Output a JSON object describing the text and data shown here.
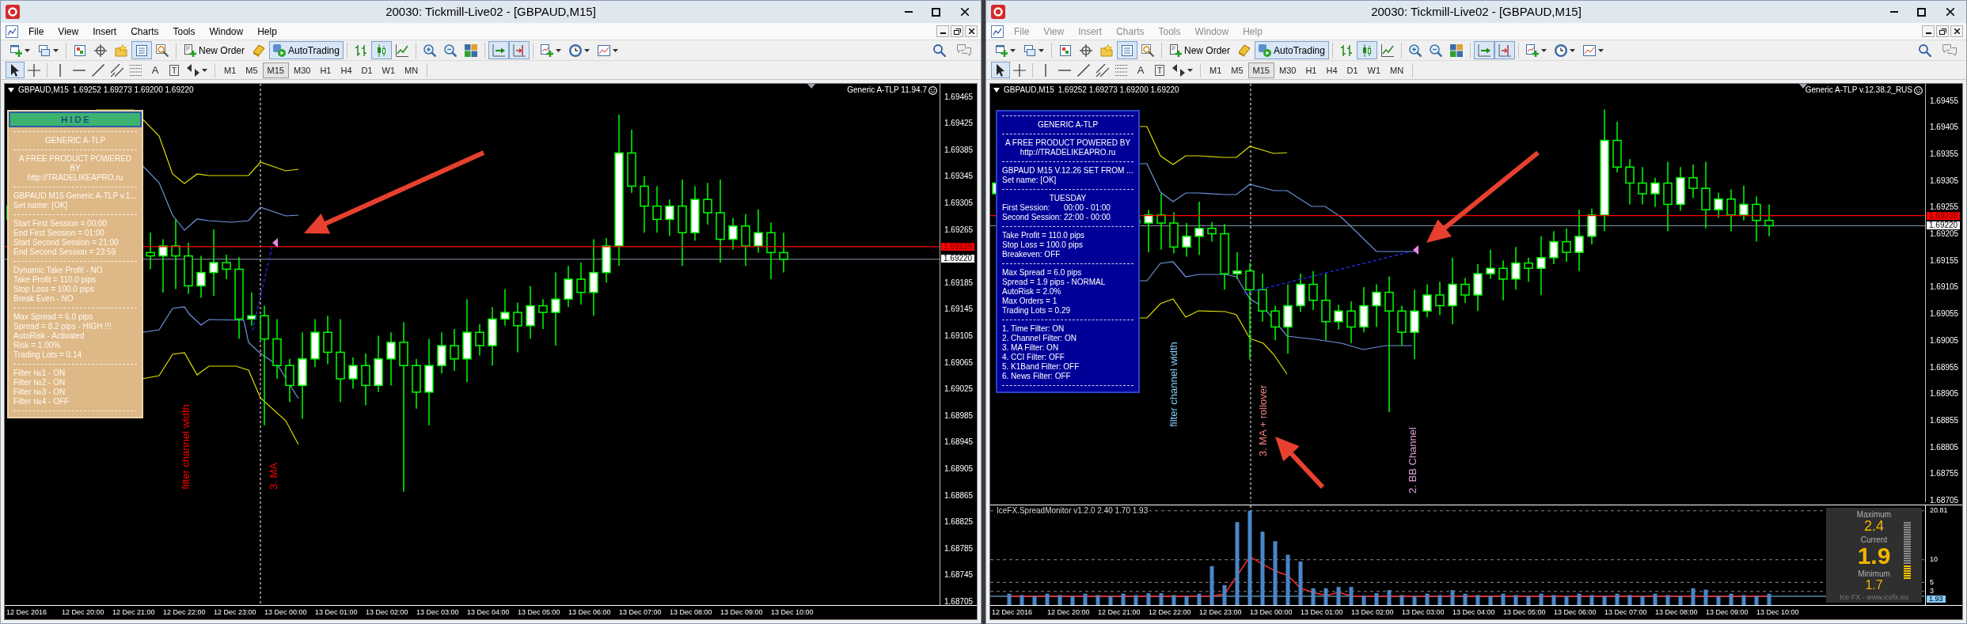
{
  "windows": [
    {
      "title": "20030: Tickmill-Live02 - [GBPAUD,M15]",
      "focused": true,
      "menu": [
        "File",
        "View",
        "Insert",
        "Charts",
        "Tools",
        "Window",
        "Help"
      ],
      "toolbar": [
        {
          "kind": "chart",
          "selected": false
        },
        {
          "kind": "profiles",
          "selected": false
        },
        {
          "kind": "market",
          "selected": false
        },
        {
          "kind": "navigator",
          "selected": false
        },
        {
          "kind": "favorites",
          "selected": false
        },
        {
          "kind": "datawindow",
          "selected": true
        },
        {
          "kind": "tester",
          "selected": false
        },
        {
          "kind": "order",
          "label": "New Order",
          "selected": false
        },
        {
          "kind": "editor",
          "selected": false
        },
        {
          "kind": "autotrading",
          "label": "AutoTrading",
          "selected": true
        },
        {
          "kind": "bars",
          "selected": false
        },
        {
          "kind": "candles",
          "selected": true
        },
        {
          "kind": "line",
          "selected": false
        },
        {
          "kind": "zoomin",
          "selected": false
        },
        {
          "kind": "zoomout",
          "selected": false
        },
        {
          "kind": "tile",
          "selected": false
        },
        {
          "kind": "autoscroll",
          "selected": true
        },
        {
          "kind": "shift",
          "selected": true
        },
        {
          "kind": "indicators",
          "selected": false
        },
        {
          "kind": "periods",
          "selected": false
        },
        {
          "kind": "templates",
          "selected": false
        }
      ],
      "drawing_tools": [
        {
          "kind": "cursor",
          "selected": true
        },
        {
          "kind": "crosshair",
          "selected": false
        },
        {
          "kind": "vline",
          "selected": false
        },
        {
          "kind": "hline",
          "selected": false
        },
        {
          "kind": "trendline",
          "selected": false
        },
        {
          "kind": "channel",
          "selected": false
        },
        {
          "kind": "fibo",
          "selected": false
        },
        {
          "kind": "text",
          "label": "A",
          "selected": false
        },
        {
          "kind": "label",
          "label": "T",
          "selected": false
        },
        {
          "kind": "arrows",
          "selected": false
        }
      ],
      "timeframes": [
        {
          "label": "M1",
          "selected": false
        },
        {
          "label": "M5",
          "selected": false
        },
        {
          "label": "M15",
          "selected": true
        },
        {
          "label": "M30",
          "selected": false
        },
        {
          "label": "H1",
          "selected": false
        },
        {
          "label": "H4",
          "selected": false
        },
        {
          "label": "D1",
          "selected": false
        },
        {
          "label": "W1",
          "selected": false
        },
        {
          "label": "MN",
          "selected": false
        }
      ],
      "chart": {
        "symbol": "GBPAUD,M15",
        "quote": "1.69252 1.69273 1.69200 1.69220",
        "expert": "Generic A-TLP 11.94.7",
        "panel": {
          "kind": "tan",
          "hide_button": "H I D E",
          "sections": [
            [
              {
                "kind": "heading",
                "text": "GENERIC A-TLP"
              }
            ],
            [
              {
                "kind": "heading",
                "text": "A FREE PRODUCT POWERED"
              },
              {
                "kind": "heading",
                "text": "BY"
              },
              {
                "kind": "heading",
                "text": "http://TRADELIKEAPRO.ru"
              }
            ],
            [
              {
                "kind": "line",
                "text": "GBPAUD M15 Generic A-TLP v.1..."
              },
              {
                "kind": "line",
                "text": "Set name: [OK]"
              }
            ],
            [
              {
                "kind": "line",
                "text": "Start First Session = 00:00"
              },
              {
                "kind": "line",
                "text": "End First Session = 01:00"
              },
              {
                "kind": "line",
                "text": "Start Second Session = 21:00"
              },
              {
                "kind": "line",
                "text": "End Second Session = 23:59"
              }
            ],
            [
              {
                "kind": "line",
                "text": "Dynamic Take Profit - NO"
              },
              {
                "kind": "line",
                "text": "Take Profit = 110.0 pips"
              },
              {
                "kind": "line",
                "text": "Stop Loss = 100.0 pips"
              },
              {
                "kind": "line",
                "text": "Break Even - NO"
              }
            ],
            [
              {
                "kind": "line",
                "text": "Max Spread = 6.0 pips"
              },
              {
                "kind": "line",
                "text": "Spread = 8.2 pips - HIGH !!!"
              },
              {
                "kind": "line",
                "text": "AutoRisk - Activated"
              },
              {
                "kind": "line",
                "text": "Risk = 1.00%"
              },
              {
                "kind": "line",
                "text": "Trading Lots = 0.14"
              }
            ],
            [
              {
                "kind": "line",
                "text": "Filter №1 - ON"
              },
              {
                "kind": "line",
                "text": "Filter №2 - ON"
              },
              {
                "kind": "line",
                "text": "Filter №3 - ON"
              },
              {
                "kind": "line",
                "text": "Filter №4 - OFF"
              }
            ]
          ]
        },
        "annotations": [
          {
            "text": "filter channel width",
            "color": "#ff0000"
          },
          {
            "text": "3. MA",
            "color": "#ff0000"
          }
        ],
        "price_axis": {
          "labels": [
            "1.69465",
            "1.69425",
            "1.69385",
            "1.69345",
            "1.69305",
            "1.69265",
            "1.69185",
            "1.69145",
            "1.69105",
            "1.69065",
            "1.69025",
            "1.68985",
            "1.68945",
            "1.68905",
            "1.68865",
            "1.68825",
            "1.68785",
            "1.68745",
            "1.68705"
          ],
          "ask": "1.69239",
          "bid": "1.69220"
        },
        "time_axis": [
          "12 Dec 2016",
          "12 Dec 20:00",
          "12 Dec 21:00",
          "12 Dec 22:00",
          "12 Dec 23:00",
          "13 Dec 00:00",
          "13 Dec 01:00",
          "13 Dec 02:00",
          "13 Dec 03:00",
          "13 Dec 04:00",
          "13 Dec 05:00",
          "13 Dec 06:00",
          "13 Dec 07:00",
          "13 Dec 08:00",
          "13 Dec 09:00",
          "13 Dec 10:00"
        ]
      }
    },
    {
      "title": "20030: Tickmill-Live02 - [GBPAUD,M15]",
      "focused": false,
      "menu": [
        "File",
        "View",
        "Insert",
        "Charts",
        "Tools",
        "Window",
        "Help"
      ],
      "toolbar": [
        {
          "kind": "chart",
          "selected": false
        },
        {
          "kind": "profiles",
          "selected": false
        },
        {
          "kind": "market",
          "selected": false
        },
        {
          "kind": "navigator",
          "selected": false
        },
        {
          "kind": "favorites",
          "selected": false
        },
        {
          "kind": "datawindow",
          "selected": true
        },
        {
          "kind": "tester",
          "selected": false
        },
        {
          "kind": "order",
          "label": "New Order",
          "selected": false
        },
        {
          "kind": "editor",
          "selected": false
        },
        {
          "kind": "autotrading",
          "label": "AutoTrading",
          "selected": true
        },
        {
          "kind": "bars",
          "selected": false
        },
        {
          "kind": "candles",
          "selected": true
        },
        {
          "kind": "line",
          "selected": false
        },
        {
          "kind": "zoomin",
          "selected": false
        },
        {
          "kind": "zoomout",
          "selected": false
        },
        {
          "kind": "tile",
          "selected": false
        },
        {
          "kind": "autoscroll",
          "selected": true
        },
        {
          "kind": "shift",
          "selected": true
        },
        {
          "kind": "indicators",
          "selected": false
        },
        {
          "kind": "periods",
          "selected": false
        },
        {
          "kind": "templates",
          "selected": false
        }
      ],
      "drawing_tools": [
        {
          "kind": "cursor",
          "selected": true
        },
        {
          "kind": "crosshair",
          "selected": false
        },
        {
          "kind": "vline",
          "selected": false
        },
        {
          "kind": "hline",
          "selected": false
        },
        {
          "kind": "trendline",
          "selected": false
        },
        {
          "kind": "channel",
          "selected": false
        },
        {
          "kind": "fibo",
          "selected": false
        },
        {
          "kind": "text",
          "label": "A",
          "selected": false
        },
        {
          "kind": "label",
          "label": "T",
          "selected": false
        },
        {
          "kind": "arrows",
          "selected": false
        }
      ],
      "timeframes": [
        {
          "label": "M1",
          "selected": false
        },
        {
          "label": "M5",
          "selected": false
        },
        {
          "label": "M15",
          "selected": true
        },
        {
          "label": "M30",
          "selected": false
        },
        {
          "label": "H1",
          "selected": false
        },
        {
          "label": "H4",
          "selected": false
        },
        {
          "label": "D1",
          "selected": false
        },
        {
          "label": "W1",
          "selected": false
        },
        {
          "label": "MN",
          "selected": false
        }
      ],
      "chart": {
        "symbol": "GBPAUD,M15",
        "quote": "1.69252 1.69273 1.69200 1.69220",
        "expert": "Generic A-TLP v.12.38.2_RUS",
        "panel": {
          "kind": "navy",
          "sections": [
            [
              {
                "kind": "heading",
                "text": "GENERIC A-TLP"
              }
            ],
            [
              {
                "kind": "heading",
                "text": "A FREE PRODUCT POWERED BY"
              },
              {
                "kind": "heading",
                "text": "http://TRADELIKEAPRO.ru"
              }
            ],
            [
              {
                "kind": "line",
                "text": "GBPAUD M15 V.12.26 SET FROM ..."
              },
              {
                "kind": "line",
                "text": "Set name: [OK]"
              }
            ],
            [
              {
                "kind": "heading",
                "text": "TUESDAY"
              },
              {
                "kind": "pair",
                "label": "First Session:",
                "value": "00:00 - 01:00"
              },
              {
                "kind": "pair",
                "label": "Second Session:",
                "value": "22:00 - 00:00"
              }
            ],
            [
              {
                "kind": "line",
                "text": "Take Profit = 110.0 pips"
              },
              {
                "kind": "line",
                "text": "Stop Loss = 100.0 pips"
              },
              {
                "kind": "line",
                "text": "Breakeven: OFF"
              }
            ],
            [
              {
                "kind": "line",
                "text": "Max Spread = 6.0 pips"
              },
              {
                "kind": "line",
                "text": "Spread = 1.9 pips - NORMAL"
              },
              {
                "kind": "line",
                "text": "AutoRisk = 2.0%"
              },
              {
                "kind": "line",
                "text": "Max Orders = 1"
              },
              {
                "kind": "line",
                "text": "Trading Lots = 0.29"
              }
            ],
            [
              {
                "kind": "line",
                "text": "1. Time Filter: ON"
              },
              {
                "kind": "line",
                "text": "2. Channel Filter: ON"
              },
              {
                "kind": "line",
                "text": "3. MA Filter: ON"
              },
              {
                "kind": "line",
                "text": "4. CCI Filter: OFF"
              },
              {
                "kind": "line",
                "text": "5. K1Band Filter: OFF"
              },
              {
                "kind": "line",
                "text": "6. News Filter: OFF"
              }
            ]
          ]
        },
        "annotations": [
          {
            "text": "filter channel width",
            "color": "#87cefa"
          },
          {
            "text": "3. MA + rollover",
            "color": "#f08080"
          },
          {
            "text": "2. BB Channel",
            "color": "#dda0dd"
          }
        ],
        "price_axis": {
          "labels": [
            "1.69455",
            "1.69405",
            "1.69355",
            "1.69305",
            "1.69255",
            "1.69205",
            "1.69155",
            "1.69105",
            "1.69055",
            "1.69005",
            "1.68955",
            "1.68905",
            "1.68855",
            "1.68805",
            "1.68755",
            "1.68705"
          ],
          "ask": "1.69239",
          "bid": "1.69220"
        },
        "indicator": {
          "title": "IceFX.SpreadMonitor v1.2.0 2.40 1.70 1.93",
          "chart_data": {
            "type": "bar",
            "ylim": [
              0,
              22
            ],
            "grid": true,
            "yticks": [
              {
                "value": 20.81,
                "label": "20.81"
              },
              {
                "value": 10,
                "label": "10"
              },
              {
                "value": 5,
                "label": "5"
              },
              {
                "value": 3,
                "label": "3"
              }
            ],
            "ref_lines": [
              {
                "axis": "y",
                "value": 1.93,
                "label": "1.93",
                "color": "#87cefa"
              }
            ],
            "categories": [
              null,
              null,
              null,
              null,
              null,
              null,
              null,
              null,
              null,
              null,
              null,
              null,
              null,
              null,
              null,
              null,
              null,
              null,
              null,
              null,
              null,
              null,
              null,
              null,
              null,
              null,
              null,
              null,
              null,
              null,
              null,
              null,
              null,
              null,
              null,
              null,
              null,
              null,
              null,
              null,
              null,
              null,
              null,
              null,
              null,
              null,
              null,
              null,
              null,
              null,
              null,
              null,
              null,
              null,
              null,
              null,
              null,
              null,
              null,
              null,
              null
            ],
            "series": [
              {
                "color": "#4a86c8",
                "values": [
                  2.5,
                  2.2,
                  2.0,
                  2.5,
                  2.2,
                  2.0,
                  2.5,
                  2.2,
                  2.0,
                  2.5,
                  2.2,
                  2.6,
                  2.6,
                  2.2,
                  2.0,
                  2.5,
                  8.6,
                  4.4,
                  18.3,
                  20.8,
                  16.2,
                  14.1,
                  11.1,
                  9.6,
                  3.7,
                  3.7,
                  4.0,
                  4.0,
                  2.1,
                  2.6,
                  3.3,
                  2.2,
                  2.0,
                  2.5,
                  2.2,
                  3.3,
                  2.5,
                  2.2,
                  2.0,
                  2.5,
                  2.2,
                  2.0,
                  2.5,
                  2.2,
                  2.0,
                  2.5,
                  2.2,
                  2.0,
                  2.5,
                  2.2,
                  2.0,
                  2.5,
                  2.2,
                  2.0,
                  3.7,
                  3.4,
                  2.0,
                  2.5,
                  2.2,
                  2.0,
                  2.5
                ]
              },
              {
                "type": "line",
                "color": "#ff2a2a",
                "values": [
                  1.9,
                  1.9,
                  1.9,
                  1.9,
                  1.9,
                  1.9,
                  1.9,
                  1.9,
                  1.9,
                  1.9,
                  1.9,
                  1.9,
                  1.9,
                  1.9,
                  1.9,
                  1.9,
                  2.0,
                  2.4,
                  6.5,
                  10.7,
                  9.0,
                  7.5,
                  6.5,
                  3.7,
                  2.8,
                  2.1,
                  2.8,
                  2.0,
                  1.9,
                  1.9,
                  1.9,
                  1.9,
                  1.9,
                  1.9,
                  1.9,
                  1.9,
                  1.9,
                  1.9,
                  1.9,
                  1.9,
                  1.9,
                  1.9,
                  1.9,
                  1.9,
                  1.9,
                  1.9,
                  1.9,
                  1.9,
                  1.9,
                  1.9,
                  1.9,
                  1.9,
                  1.9,
                  1.9,
                  1.9,
                  1.9,
                  1.9,
                  1.9,
                  1.9,
                  1.9,
                  1.9
                ]
              }
            ]
          },
          "gauge": {
            "maximum_label": "Maximum",
            "maximum": "2.4",
            "current_label": "Current",
            "current": "1.9",
            "minimum_label": "Minimum",
            "minimum": "1.7",
            "level": 0.25,
            "credit": "Ice FX - www.icefx.eu"
          }
        },
        "time_axis": [
          "12 Dec 2016",
          "12 Dec 20:00",
          "12 Dec 21:00",
          "12 Dec 22:00",
          "12 Dec 23:00",
          "13 Dec 00:00",
          "13 Dec 01:00",
          "13 Dec 02:00",
          "13 Dec 03:00",
          "13 Dec 04:00",
          "13 Dec 05:00",
          "13 Dec 06:00",
          "13 Dec 07:00",
          "13 Dec 08:00",
          "13 Dec 09:00",
          "13 Dec 10:00"
        ]
      }
    }
  ]
}
